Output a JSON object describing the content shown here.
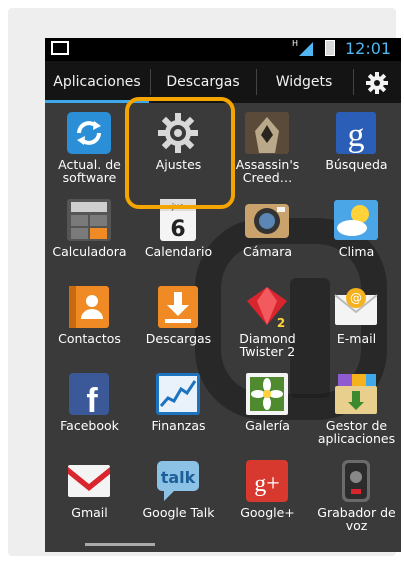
{
  "status": {
    "time": "12:01",
    "signal_badge": "H"
  },
  "tabs": [
    {
      "label": "Aplicaciones"
    },
    {
      "label": "Descargas"
    },
    {
      "label": "Widgets"
    }
  ],
  "apps": [
    {
      "label": "Actual. de software",
      "icon": "software-update-icon"
    },
    {
      "label": "Ajustes",
      "icon": "settings-gear-icon"
    },
    {
      "label": "Assassin's Creed…",
      "icon": "assassins-creed-icon"
    },
    {
      "label": "Búsqueda",
      "icon": "google-search-icon"
    },
    {
      "label": "Calculadora",
      "icon": "calculator-icon"
    },
    {
      "label": "Calendario",
      "icon": "calendar-icon",
      "badge_top": "jue",
      "badge_day": "6"
    },
    {
      "label": "Cámara",
      "icon": "camera-icon"
    },
    {
      "label": "Clima",
      "icon": "weather-icon"
    },
    {
      "label": "Contactos",
      "icon": "contacts-icon"
    },
    {
      "label": "Descargas",
      "icon": "downloads-icon"
    },
    {
      "label": "Diamond Twister 2",
      "icon": "diamond-twister-icon"
    },
    {
      "label": "E-mail",
      "icon": "email-icon"
    },
    {
      "label": "Facebook",
      "icon": "facebook-icon"
    },
    {
      "label": "Finanzas",
      "icon": "finance-icon"
    },
    {
      "label": "Galería",
      "icon": "gallery-icon"
    },
    {
      "label": "Gestor de aplicaciones",
      "icon": "app-manager-icon"
    },
    {
      "label": "Gmail",
      "icon": "gmail-icon"
    },
    {
      "label": "Google Talk",
      "icon": "google-talk-icon",
      "badge": "talk"
    },
    {
      "label": "Google+",
      "icon": "google-plus-icon",
      "badge": "g+"
    },
    {
      "label": "Grabador de voz",
      "icon": "voice-recorder-icon"
    }
  ],
  "highlight_color": "#f5a500",
  "accent": "#3ea8e8"
}
